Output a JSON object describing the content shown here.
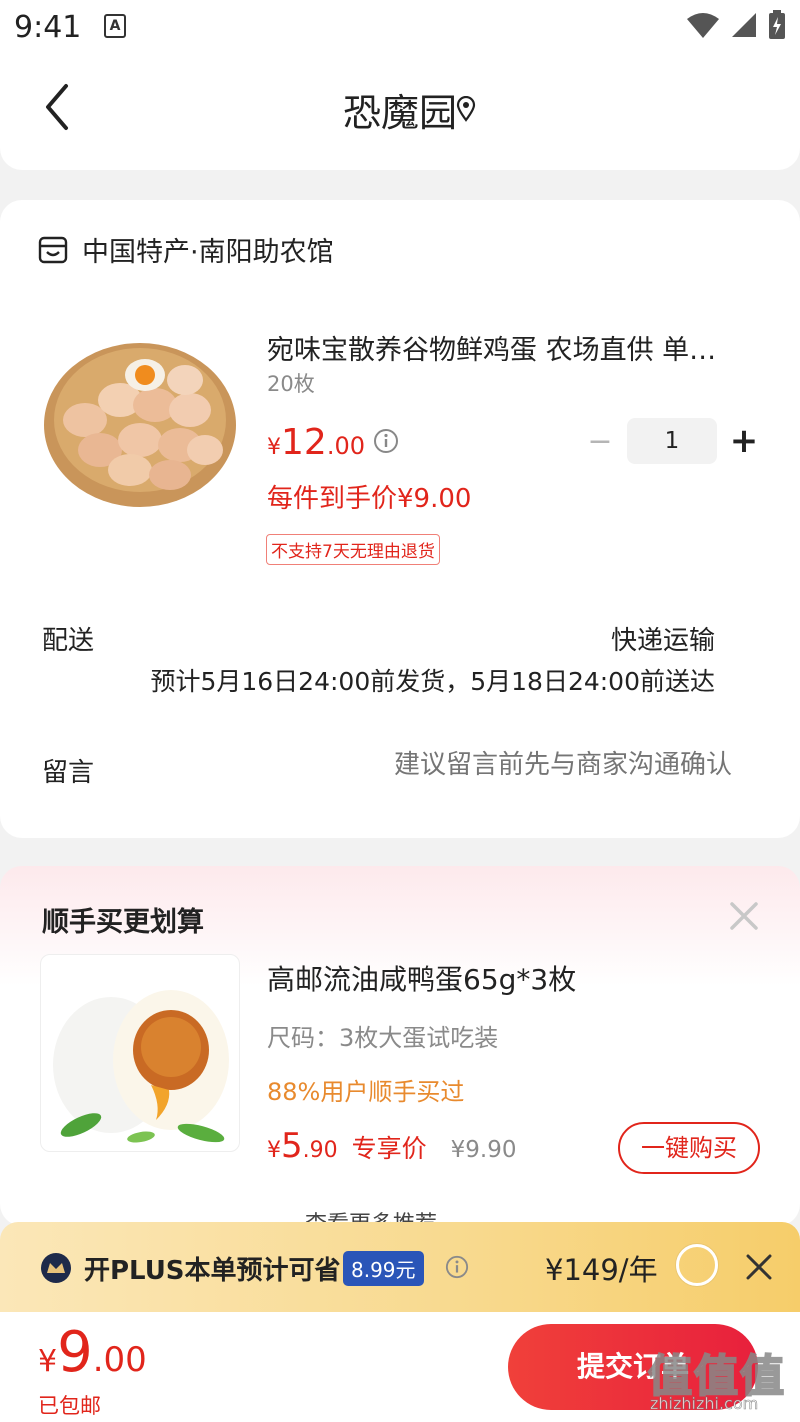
{
  "status_bar": {
    "time": "9:41",
    "notif_letter": "A"
  },
  "header": {
    "title": "恐魔园"
  },
  "shop": {
    "name": "中国特产·南阳助农馆"
  },
  "product": {
    "title": "宛味宝散养谷物鲜鸡蛋 农场直供 单…",
    "spec": "20枚",
    "price_symbol": "¥",
    "price_int": "12",
    "price_dec": ".00",
    "quantity": "1",
    "final_price": "每件到手价¥9.00",
    "return_policy": "不支持7天无理由退货"
  },
  "shipping": {
    "label": "配送",
    "method": "快递运输",
    "estimate": "预计5月16日24:00前发货，5月18日24:00前送达"
  },
  "note": {
    "label": "留言",
    "placeholder": "建议留言前先与商家沟通确认"
  },
  "recommend": {
    "section_title": "顺手买更划算",
    "title": "高邮流油咸鸭蛋65g*3枚",
    "spec": "尺码：3枚大蛋试吃装",
    "bought": "88%用户顺手买过",
    "price_symbol": "¥",
    "price_int": "5",
    "price_dec": ".90",
    "price_tag": "专享价",
    "orig_price": "¥9.90",
    "buy_label": "一键购买",
    "more_peek": "查看更多推荐"
  },
  "plus": {
    "text": "开PLUS本单预计可省",
    "save": "8.99元",
    "price": "¥149/年"
  },
  "bottom": {
    "total_symbol": "¥",
    "total_int": "9",
    "total_dec": ".00",
    "free_ship": "已包邮",
    "submit_label": "提交订单"
  },
  "watermark": {
    "glyphs": "值值值",
    "url": "zhizhizhi.com"
  },
  "colors": {
    "accent": "#e1251b",
    "orange": "#e88a2e",
    "plus_blue": "#2a55b8"
  }
}
